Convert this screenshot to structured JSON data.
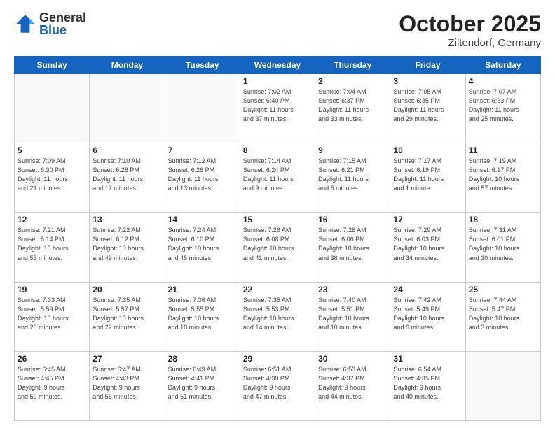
{
  "header": {
    "logo_general": "General",
    "logo_blue": "Blue",
    "month": "October 2025",
    "location": "Ziltendorf, Germany"
  },
  "days_of_week": [
    "Sunday",
    "Monday",
    "Tuesday",
    "Wednesday",
    "Thursday",
    "Friday",
    "Saturday"
  ],
  "weeks": [
    [
      {
        "day": "",
        "info": ""
      },
      {
        "day": "",
        "info": ""
      },
      {
        "day": "",
        "info": ""
      },
      {
        "day": "1",
        "info": "Sunrise: 7:02 AM\nSunset: 6:40 PM\nDaylight: 11 hours\nand 37 minutes."
      },
      {
        "day": "2",
        "info": "Sunrise: 7:04 AM\nSunset: 6:37 PM\nDaylight: 11 hours\nand 33 minutes."
      },
      {
        "day": "3",
        "info": "Sunrise: 7:05 AM\nSunset: 6:35 PM\nDaylight: 11 hours\nand 29 minutes."
      },
      {
        "day": "4",
        "info": "Sunrise: 7:07 AM\nSunset: 6:33 PM\nDaylight: 11 hours\nand 25 minutes."
      }
    ],
    [
      {
        "day": "5",
        "info": "Sunrise: 7:09 AM\nSunset: 6:30 PM\nDaylight: 11 hours\nand 21 minutes."
      },
      {
        "day": "6",
        "info": "Sunrise: 7:10 AM\nSunset: 6:28 PM\nDaylight: 11 hours\nand 17 minutes."
      },
      {
        "day": "7",
        "info": "Sunrise: 7:12 AM\nSunset: 6:26 PM\nDaylight: 11 hours\nand 13 minutes."
      },
      {
        "day": "8",
        "info": "Sunrise: 7:14 AM\nSunset: 6:24 PM\nDaylight: 11 hours\nand 9 minutes."
      },
      {
        "day": "9",
        "info": "Sunrise: 7:15 AM\nSunset: 6:21 PM\nDaylight: 11 hours\nand 5 minutes."
      },
      {
        "day": "10",
        "info": "Sunrise: 7:17 AM\nSunset: 6:19 PM\nDaylight: 11 hours\nand 1 minute."
      },
      {
        "day": "11",
        "info": "Sunrise: 7:19 AM\nSunset: 6:17 PM\nDaylight: 10 hours\nand 57 minutes."
      }
    ],
    [
      {
        "day": "12",
        "info": "Sunrise: 7:21 AM\nSunset: 6:14 PM\nDaylight: 10 hours\nand 53 minutes."
      },
      {
        "day": "13",
        "info": "Sunrise: 7:22 AM\nSunset: 6:12 PM\nDaylight: 10 hours\nand 49 minutes."
      },
      {
        "day": "14",
        "info": "Sunrise: 7:24 AM\nSunset: 6:10 PM\nDaylight: 10 hours\nand 45 minutes."
      },
      {
        "day": "15",
        "info": "Sunrise: 7:26 AM\nSunset: 6:08 PM\nDaylight: 10 hours\nand 41 minutes."
      },
      {
        "day": "16",
        "info": "Sunrise: 7:28 AM\nSunset: 6:06 PM\nDaylight: 10 hours\nand 38 minutes."
      },
      {
        "day": "17",
        "info": "Sunrise: 7:29 AM\nSunset: 6:03 PM\nDaylight: 10 hours\nand 34 minutes."
      },
      {
        "day": "18",
        "info": "Sunrise: 7:31 AM\nSunset: 6:01 PM\nDaylight: 10 hours\nand 30 minutes."
      }
    ],
    [
      {
        "day": "19",
        "info": "Sunrise: 7:33 AM\nSunset: 5:59 PM\nDaylight: 10 hours\nand 26 minutes."
      },
      {
        "day": "20",
        "info": "Sunrise: 7:35 AM\nSunset: 5:57 PM\nDaylight: 10 hours\nand 22 minutes."
      },
      {
        "day": "21",
        "info": "Sunrise: 7:36 AM\nSunset: 5:55 PM\nDaylight: 10 hours\nand 18 minutes."
      },
      {
        "day": "22",
        "info": "Sunrise: 7:38 AM\nSunset: 5:53 PM\nDaylight: 10 hours\nand 14 minutes."
      },
      {
        "day": "23",
        "info": "Sunrise: 7:40 AM\nSunset: 5:51 PM\nDaylight: 10 hours\nand 10 minutes."
      },
      {
        "day": "24",
        "info": "Sunrise: 7:42 AM\nSunset: 5:49 PM\nDaylight: 10 hours\nand 6 minutes."
      },
      {
        "day": "25",
        "info": "Sunrise: 7:44 AM\nSunset: 5:47 PM\nDaylight: 10 hours\nand 3 minutes."
      }
    ],
    [
      {
        "day": "26",
        "info": "Sunrise: 6:45 AM\nSunset: 4:45 PM\nDaylight: 9 hours\nand 59 minutes."
      },
      {
        "day": "27",
        "info": "Sunrise: 6:47 AM\nSunset: 4:43 PM\nDaylight: 9 hours\nand 55 minutes."
      },
      {
        "day": "28",
        "info": "Sunrise: 6:49 AM\nSunset: 4:41 PM\nDaylight: 9 hours\nand 51 minutes."
      },
      {
        "day": "29",
        "info": "Sunrise: 6:51 AM\nSunset: 4:39 PM\nDaylight: 9 hours\nand 47 minutes."
      },
      {
        "day": "30",
        "info": "Sunrise: 6:53 AM\nSunset: 4:37 PM\nDaylight: 9 hours\nand 44 minutes."
      },
      {
        "day": "31",
        "info": "Sunrise: 6:54 AM\nSunset: 4:35 PM\nDaylight: 9 hours\nand 40 minutes."
      },
      {
        "day": "",
        "info": ""
      }
    ]
  ]
}
